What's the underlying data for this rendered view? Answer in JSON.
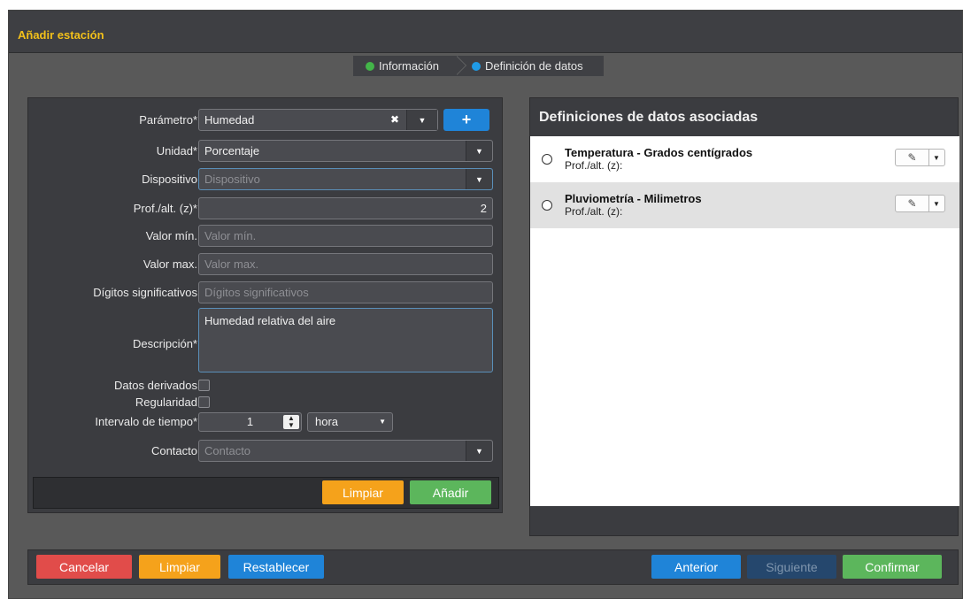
{
  "dialog": {
    "title": "Añadir estación"
  },
  "steps": [
    {
      "label": "Información",
      "color": "#43b549"
    },
    {
      "label": "Definición de datos",
      "color": "#1f9be6"
    }
  ],
  "form": {
    "parametro": {
      "label": "Parámetro*",
      "value": "Humedad",
      "clear_icon": "✖",
      "add_icon": "+"
    },
    "unidad": {
      "label": "Unidad*",
      "value": "Porcentaje"
    },
    "dispositivo": {
      "label": "Dispositivo",
      "placeholder": "Dispositivo"
    },
    "prof": {
      "label": "Prof./alt. (z)*",
      "value": "2"
    },
    "valor_min": {
      "label": "Valor mín.",
      "placeholder": "Valor mín."
    },
    "valor_max": {
      "label": "Valor max.",
      "placeholder": "Valor max."
    },
    "digitos": {
      "label": "Dígitos significativos",
      "placeholder": "Dígitos significativos"
    },
    "descripcion": {
      "label": "Descripción*",
      "value": "Humedad relativa del aire"
    },
    "derivados": {
      "label": "Datos derivados"
    },
    "regularidad": {
      "label": "Regularidad"
    },
    "intervalo": {
      "label": "Intervalo de tiempo*",
      "value": "1",
      "unit": "hora"
    },
    "contacto": {
      "label": "Contacto",
      "placeholder": "Contacto"
    },
    "buttons": {
      "limpiar": "Limpiar",
      "anadir": "Añadir"
    }
  },
  "right_panel": {
    "title": "Definiciones de datos asociadas",
    "items": [
      {
        "title": "Temperatura - Grados centígrados",
        "sub": "Prof./alt. (z):"
      },
      {
        "title": "Pluviometría - Milimetros",
        "sub": "Prof./alt. (z):"
      }
    ]
  },
  "bottom": {
    "cancelar": "Cancelar",
    "limpiar": "Limpiar",
    "restablecer": "Restablecer",
    "anterior": "Anterior",
    "siguiente": "Siguiente",
    "confirmar": "Confirmar"
  }
}
